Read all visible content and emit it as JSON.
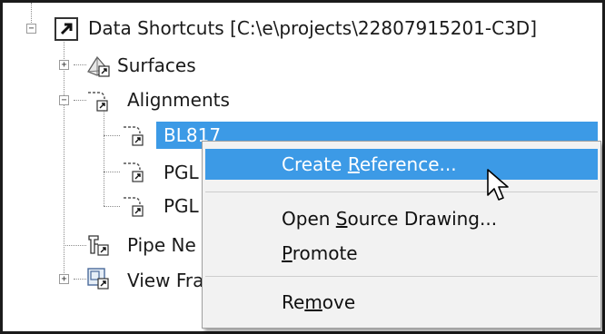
{
  "tree": {
    "root": {
      "label": "Data Shortcuts [C:\\e\\projects\\22807915201-C3D]",
      "expander": "−"
    },
    "surfaces": {
      "label": "Surfaces",
      "expander": "+"
    },
    "alignments": {
      "label": "Alignments",
      "expander": "−",
      "children": [
        {
          "label": "BL817",
          "selected": true
        },
        {
          "label": "PGL"
        },
        {
          "label": "PGL"
        }
      ]
    },
    "pipe_networks": {
      "label": "Pipe Ne"
    },
    "view_frames": {
      "label": "View Fra",
      "expander": "+"
    }
  },
  "context_menu": {
    "create_reference": {
      "pre": "Create ",
      "mnemonic": "R",
      "post": "eference..."
    },
    "open_source_drawing": {
      "pre": "Open ",
      "mnemonic": "S",
      "post": "ource Drawing..."
    },
    "promote": {
      "pre": "",
      "mnemonic": "P",
      "post": "romote"
    },
    "remove": {
      "pre": "Re",
      "mnemonic": "m",
      "post": "ove"
    }
  },
  "colors": {
    "selection": "#3c9ae6",
    "menu_background": "#f2f2f2",
    "outer_border": "#1b1b1b"
  },
  "icons": {
    "root": "shortcut-arrow-icon",
    "surfaces": "surface-icon",
    "alignments": "alignment-icon",
    "pipe_networks": "pipe-network-icon",
    "view_frames": "view-frame-icon",
    "cursor": "mouse-pointer-icon"
  }
}
